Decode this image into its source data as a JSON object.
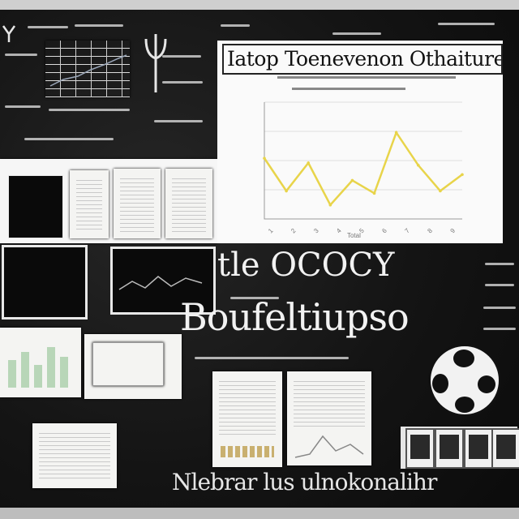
{
  "main_chart": {
    "title": "Iatop Toenevenon Othaiture",
    "footer": "Total"
  },
  "chart_data": {
    "type": "line",
    "title": "Iatop Toenevenon Othaiture",
    "categories": [
      "1",
      "2",
      "3",
      "4",
      "5",
      "6",
      "7",
      "8",
      "9"
    ],
    "values": [
      52,
      24,
      48,
      12,
      33,
      22,
      74,
      46,
      24,
      38
    ],
    "ylim": [
      0,
      100
    ],
    "grid": true,
    "line_color": "#e8d44a"
  },
  "headline": {
    "line1": "tle OCOCY",
    "line2": "Boufeltiupso"
  },
  "bottom_caption": "Nlebrar lus ulnokonalihr",
  "colors": {
    "board": "#151515",
    "chalk": "#e9e9e9",
    "paper": "#f4f4f2",
    "series": "#e8d44a"
  }
}
